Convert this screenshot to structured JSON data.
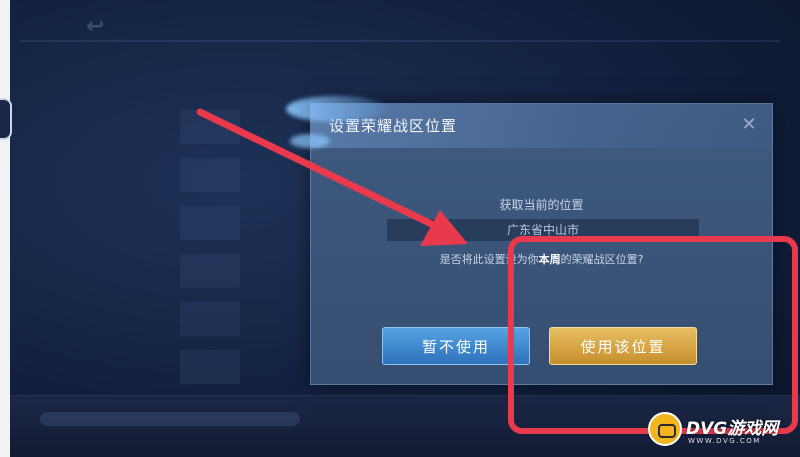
{
  "dialog": {
    "title": "设置荣耀战区位置",
    "close_icon": "close-icon",
    "location_label": "获取当前的位置",
    "location_value": "广东省中山市",
    "question_prefix": "是否将此设置设为你",
    "question_highlight": "本周",
    "question_suffix": "的荣耀战区位置?",
    "cancel_label": "暂不使用",
    "confirm_label": "使用该位置"
  },
  "annotation": {
    "highlight_color": "#e8394d"
  },
  "watermark": {
    "brand": "DVG游戏网",
    "url": "WWW.DVG.COM",
    "icon": "gamepad-icon"
  },
  "colors": {
    "cancel_button": "#3b86d0",
    "confirm_button": "#d9a440",
    "dialog_bg": "#3d5679"
  }
}
